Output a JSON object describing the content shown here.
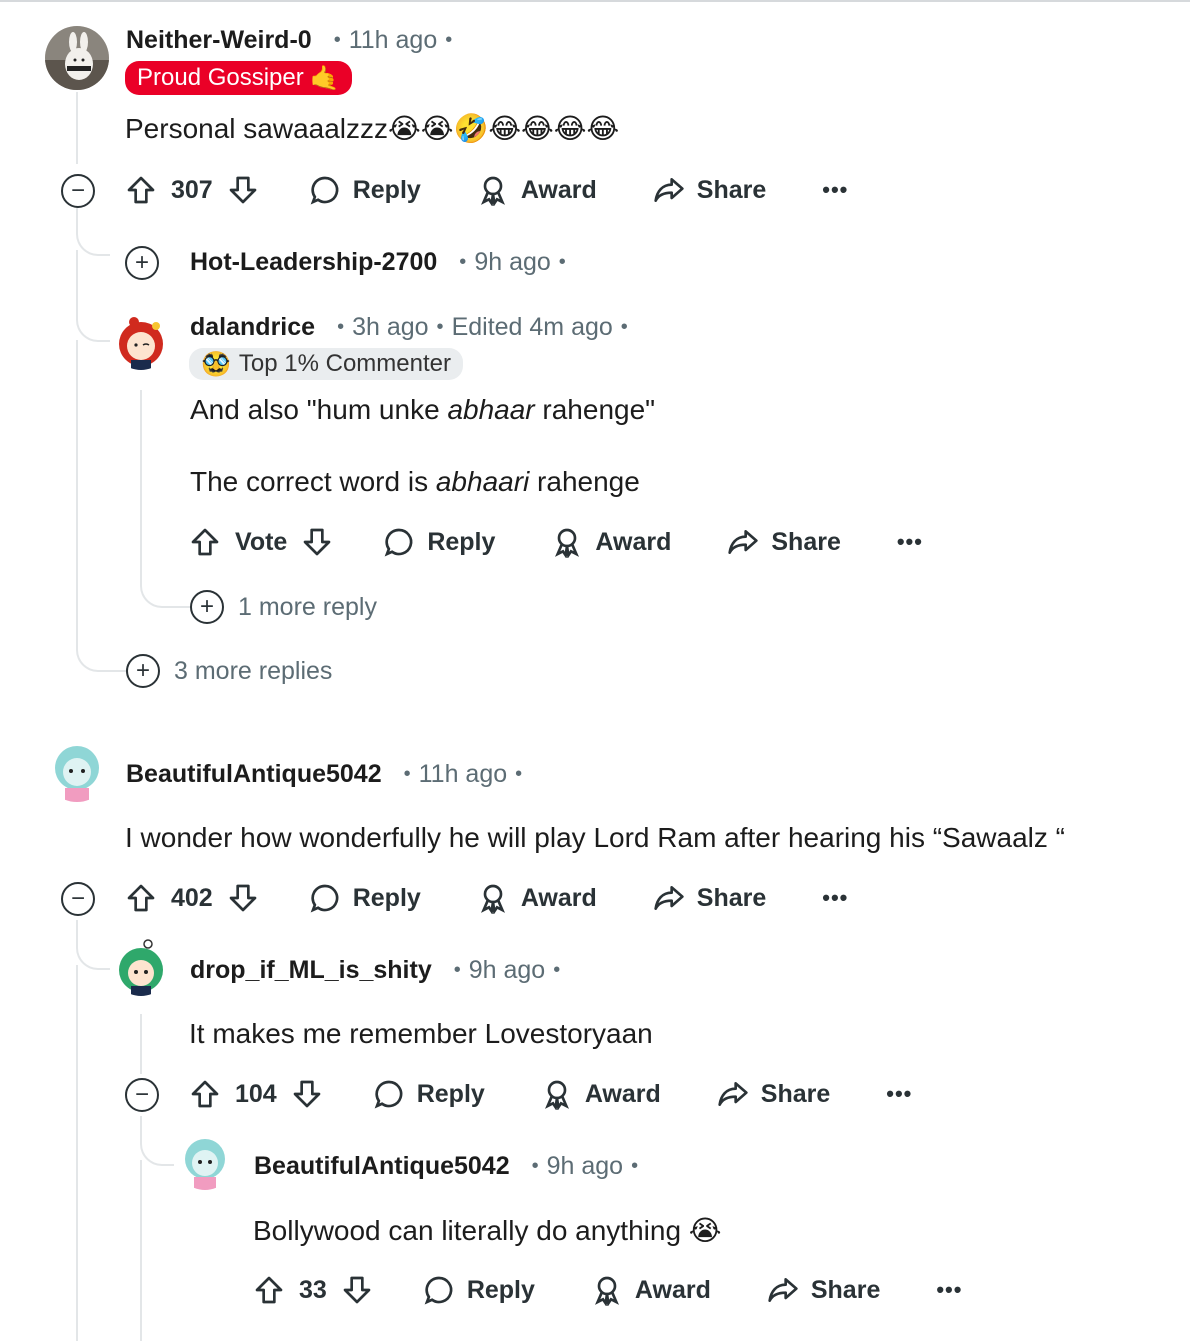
{
  "comments": [
    {
      "username": "Neither-Weird-0",
      "time": "11h ago",
      "flair": "Proud Gossiper",
      "flair_emoji": "🤙",
      "body": "Personal sawaaalzzz😭😭🤣😂😂😂😂",
      "votes": "307",
      "replies": [
        {
          "username": "Hot-Leadership-2700",
          "time": "9h ago",
          "collapsed": true
        },
        {
          "username": "dalandrice",
          "time": "3h ago",
          "edited": "Edited 4m ago",
          "flair": "Top 1% Commenter",
          "flair_emoji": "🥸",
          "body_line1_pre": "And also \"hum unke ",
          "body_line1_em": "abhaar",
          "body_line1_post": " rahenge\"",
          "body_line2_pre": "The correct word is ",
          "body_line2_em": "abhaari",
          "body_line2_post": " rahenge",
          "votes": "Vote",
          "more_replies": "1 more reply"
        }
      ],
      "more_replies": "3 more replies"
    },
    {
      "username": "BeautifulAntique5042",
      "time": "11h ago",
      "body": "I wonder how wonderfully he will play Lord Ram after hearing his “Sawaalz “",
      "votes": "402",
      "replies": [
        {
          "username": "drop_if_ML_is_shity",
          "time": "9h ago",
          "body": "It makes me remember Lovestoryaan",
          "votes": "104",
          "replies": [
            {
              "username": "BeautifulAntique5042",
              "time": "9h ago",
              "body": "Bollywood can literally do anything 😭",
              "votes": "33"
            }
          ]
        }
      ]
    }
  ],
  "actions": {
    "reply": "Reply",
    "award": "Award",
    "share": "Share",
    "more": "•••"
  },
  "colors": {
    "flair_red": "#ea0027",
    "thread_line": "#e3e6e8",
    "meta": "#5c6c74"
  }
}
